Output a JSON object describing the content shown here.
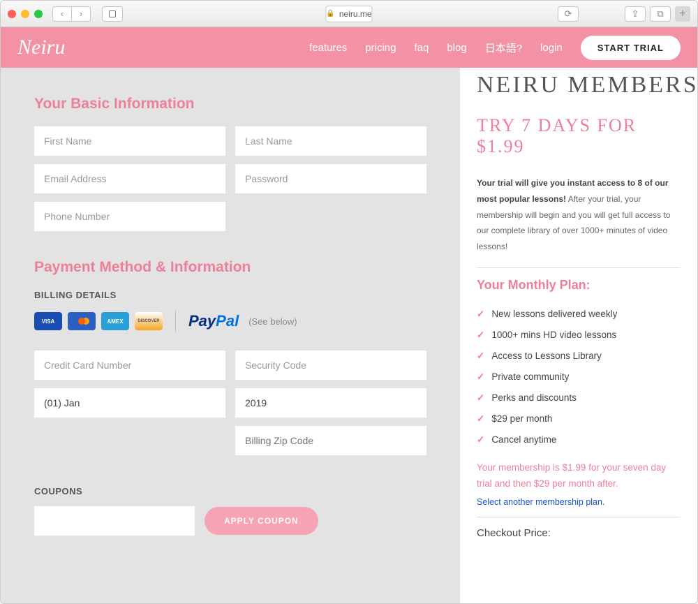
{
  "browser": {
    "url": "neiru.me"
  },
  "nav": {
    "brand": "Neiru",
    "links": [
      "features",
      "pricing",
      "faq",
      "blog",
      "日本語?",
      "login"
    ],
    "cta": "START TRIAL"
  },
  "form": {
    "basic_heading": "Your Basic Information",
    "first_name_ph": "First Name",
    "last_name_ph": "Last Name",
    "email_ph": "Email Address",
    "password_ph": "Password",
    "phone_ph": "Phone Number",
    "payment_heading": "Payment Method & Information",
    "billing_label": "BILLING DETAILS",
    "see_below": "(See below)",
    "cc_ph": "Credit Card Number",
    "cvv_ph": "Security Code",
    "month_value": "(01) Jan",
    "year_value": "2019",
    "zip_ph": "Billing Zip Code",
    "coupons_label": "COUPONS",
    "apply_label": "APPLY COUPON"
  },
  "sidebar": {
    "title": "NEIRU MEMBERSHIP",
    "subtitle": "TRY 7 DAYS FOR $1.99",
    "para_bold": "Your trial will give you instant access to 8 of our most popular lessons!",
    "para_rest": " After your trial, your membership will begin and you will get full access to our complete library of over 1000+ minutes of video lessons!",
    "plan_heading": "Your Monthly Plan:",
    "features": [
      "New lessons delivered weekly",
      "1000+ mins HD video lessons",
      "Access to Lessons Library",
      "Private community",
      "Perks and discounts",
      "$29 per month",
      "Cancel anytime"
    ],
    "price_note": "Your membership is $1.99 for your seven day trial and then $29 per month after.",
    "other_plan": "Select another membership plan.",
    "checkout_label": "Checkout Price:"
  }
}
